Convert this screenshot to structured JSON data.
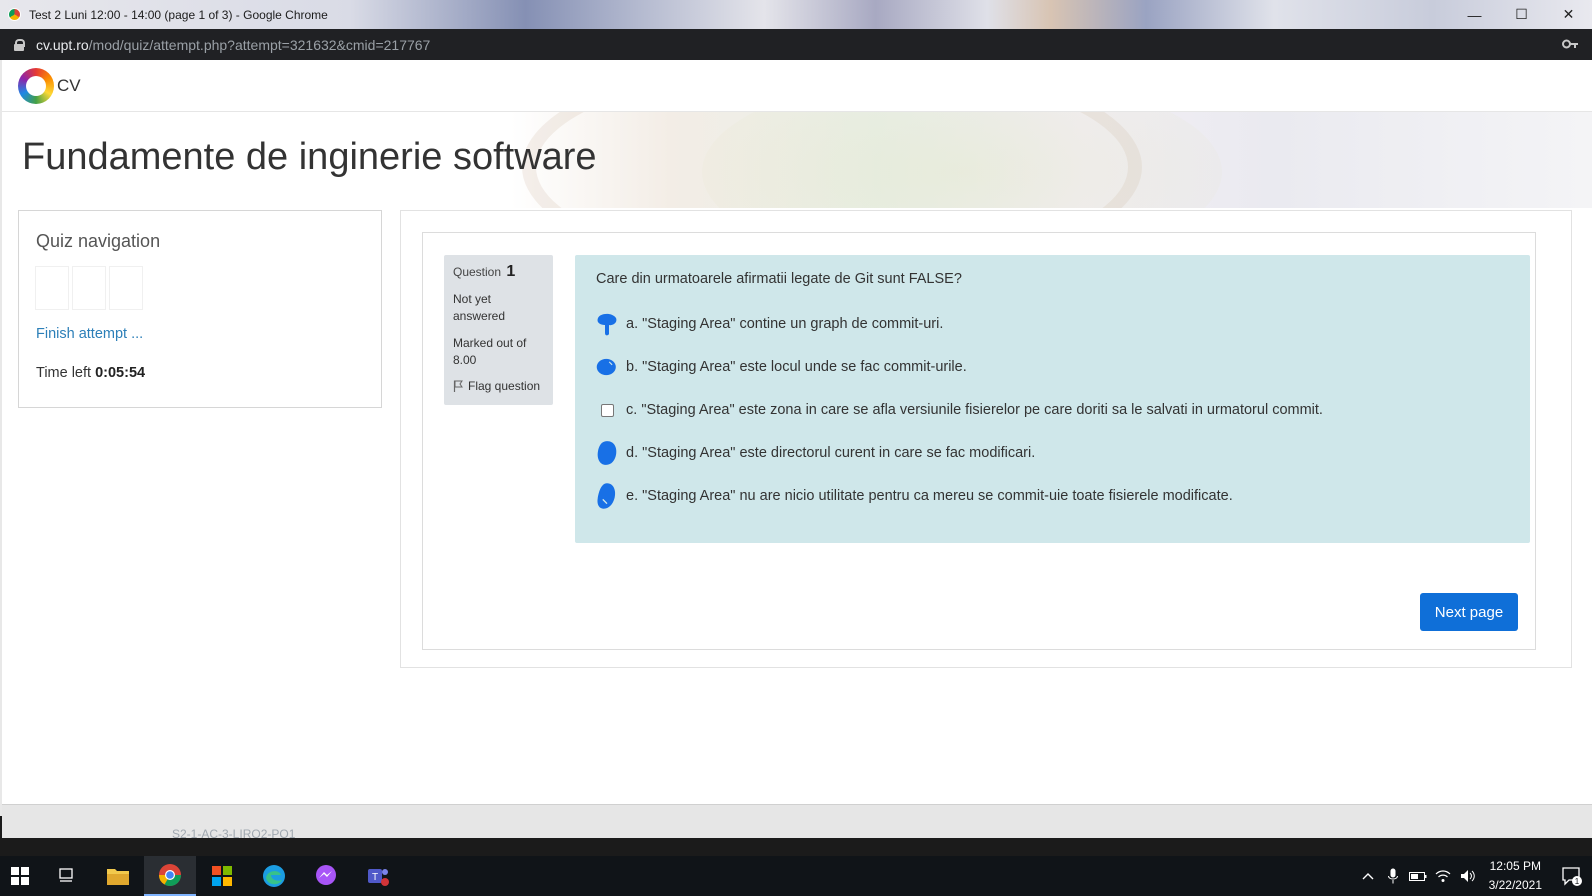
{
  "browser": {
    "window_title": "Test 2 Luni 12:00 - 14:00 (page 1 of 3) - Google Chrome",
    "url_host": "cv.upt.ro",
    "url_path": "/mod/quiz/attempt.php?attempt=321632&cmid=217767",
    "minimize_glyph": "—",
    "maximize_glyph": "☐",
    "close_glyph": "✕"
  },
  "site": {
    "name": "CV"
  },
  "page": {
    "title": "Fundamente de inginerie software"
  },
  "quiz_nav": {
    "title": "Quiz navigation",
    "finish_link": "Finish attempt ...",
    "time_left_label": "Time left",
    "time_left_value": "0:05:54"
  },
  "question": {
    "label": "Question",
    "number": "1",
    "status": "Not yet answered",
    "marked_out_of": "Marked out of 8.00",
    "flag_label": "Flag question",
    "text": "Care din urmatoarele afirmatii legate de Git sunt FALSE?",
    "answers": [
      {
        "letter": "a.",
        "text": "\"Staging Area\" contine un graph de commit-uri.",
        "marked": true
      },
      {
        "letter": "b.",
        "text": "\"Staging Area\" este locul unde se fac commit-urile.",
        "marked": true
      },
      {
        "letter": "c.",
        "text": "\"Staging Area\" este zona in care se afla versiunile fisierelor pe care doriti sa le salvati in urmatorul commit.",
        "marked": false
      },
      {
        "letter": "d.",
        "text": "\"Staging Area\" este directorul curent in care se fac modificari.",
        "marked": true
      },
      {
        "letter": "e.",
        "text": "\"Staging Area\" nu are nicio utilitate pentru ca mereu se commit-uie toate fisierele modificate.",
        "marked": true
      }
    ]
  },
  "actions": {
    "next_page": "Next page"
  },
  "footer": {
    "partial_text": "S2-1-AC-3-LIRO2-PO1"
  },
  "taskbar": {
    "time": "12:05 PM",
    "date": "3/22/2021",
    "notification_count": "1"
  },
  "colors": {
    "accent": "#0f6fd8",
    "question_bg": "#cfe7ea",
    "info_bg": "#dee2e6",
    "link": "#2c7fb8",
    "marker": "#1870e6"
  }
}
